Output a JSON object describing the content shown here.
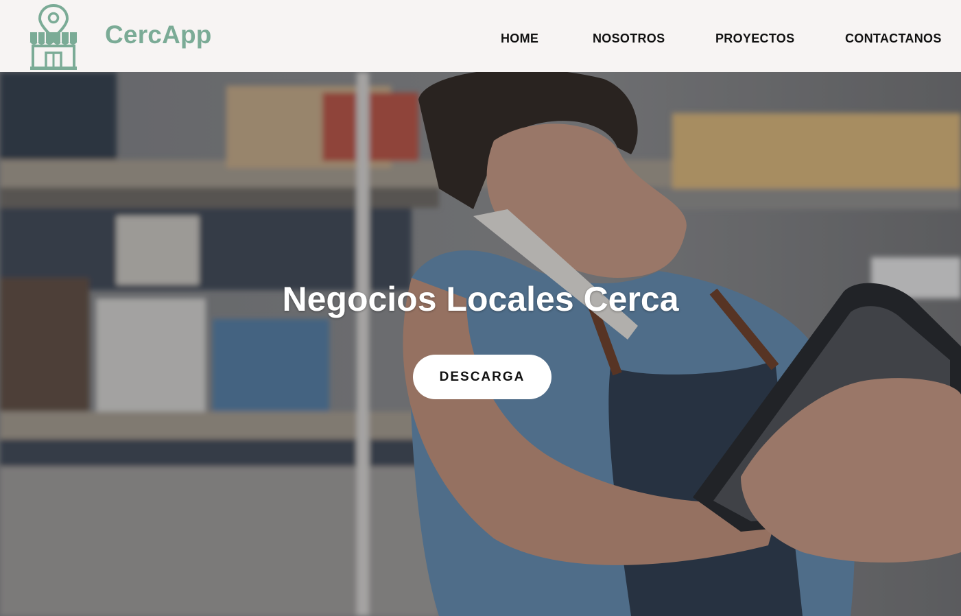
{
  "brand": {
    "name": "CercApp",
    "logo_icon": "storefront-location-pin-icon",
    "accent_color": "#7bab96"
  },
  "nav": {
    "items": [
      {
        "label": "HOME"
      },
      {
        "label": "NOSOTROS"
      },
      {
        "label": "PROYECTOS"
      },
      {
        "label": "CONTACTANOS"
      }
    ]
  },
  "hero": {
    "title": "Negocios Locales Cerca",
    "cta_label": "DESCARGA",
    "background_image": "shopkeeper-on-phone-holding-tablet-photo"
  }
}
